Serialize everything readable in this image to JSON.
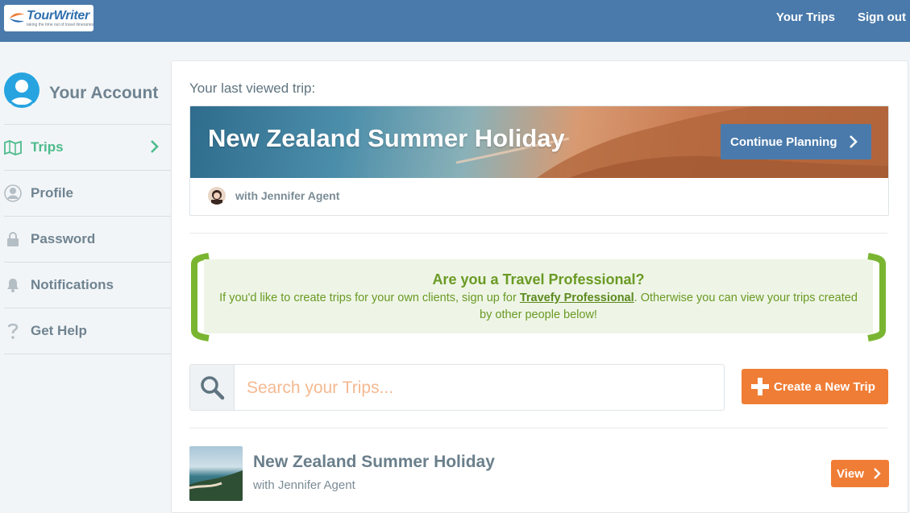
{
  "header": {
    "logo_name": "TourWriter",
    "logo_tagline": "taking the time out of travel itineraries",
    "nav": [
      "Your Trips",
      "Sign out"
    ]
  },
  "sidebar": {
    "account_title": "Your Account",
    "items": [
      {
        "label": "Trips",
        "icon": "map-icon",
        "active": true
      },
      {
        "label": "Profile",
        "icon": "user-icon",
        "active": false
      },
      {
        "label": "Password",
        "icon": "lock-icon",
        "active": false
      },
      {
        "label": "Notifications",
        "icon": "bell-icon",
        "active": false
      },
      {
        "label": "Get Help",
        "icon": "question-icon",
        "active": false
      }
    ]
  },
  "main": {
    "last_viewed_label": "Your last viewed trip:",
    "hero": {
      "title": "New Zealand Summer Holiday",
      "continue_label": "Continue Planning",
      "agent": "with Jennifer Agent"
    },
    "promo": {
      "question": "Are you a Travel Professional?",
      "text_before": "If you'd like to create trips for your own clients, sign up for ",
      "link": "Travefy Professional",
      "text_after": ". Otherwise you can view your trips created by other people below!"
    },
    "search": {
      "placeholder": "Search your Trips..."
    },
    "create_label": "Create a New Trip",
    "trips": [
      {
        "name": "New Zealand Summer Holiday",
        "with": "with Jennifer Agent",
        "view_label": "View"
      }
    ]
  },
  "colors": {
    "header": "#4a7aab",
    "active": "#4dbb8c",
    "promo_green": "#6a9a24",
    "orange": "#f07d35"
  }
}
